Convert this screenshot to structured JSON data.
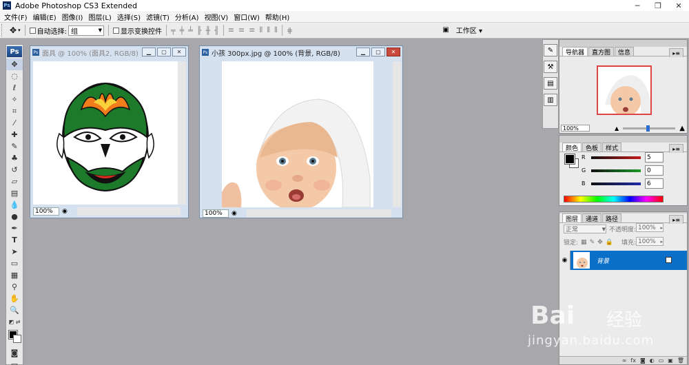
{
  "app": {
    "title": "Adobe Photoshop CS3 Extended",
    "ps_label": "Ps",
    "win_minimize": "─",
    "win_restore": "❐",
    "win_close": "✕"
  },
  "menu": [
    "文件(F)",
    "编辑(E)",
    "图像(I)",
    "图层(L)",
    "选择(S)",
    "滤镜(T)",
    "分析(A)",
    "视图(V)",
    "窗口(W)",
    "帮助(H)"
  ],
  "options": {
    "auto_select_label": "自动选择:",
    "auto_select_value": "组",
    "show_transform_label": "显示变换控件",
    "workspace_label": "工作区 ▾"
  },
  "documents": [
    {
      "title": "面具 @ 100% (面具2, RGB/8)",
      "zoom": "100%"
    },
    {
      "title": "小孩 300px.jpg @ 100% (背景, RGB/8)",
      "zoom": "100%"
    }
  ],
  "navigator": {
    "tabs": [
      "导航器",
      "直方图",
      "信息"
    ],
    "zoom": "100%"
  },
  "color_panel": {
    "tabs": [
      "颜色",
      "色板",
      "样式"
    ],
    "channels": [
      {
        "name": "R",
        "value": "5",
        "color": "#c41b1b"
      },
      {
        "name": "G",
        "value": "0",
        "color": "#1a9b2a"
      },
      {
        "name": "B",
        "value": "6",
        "color": "#1f2aa8"
      }
    ]
  },
  "layers_panel": {
    "tabs": [
      "图层",
      "通道",
      "路径"
    ],
    "blend_mode": "正常",
    "opacity_label": "不透明度:",
    "opacity_value": "100%",
    "lock_label": "锁定:",
    "fill_label": "填充:",
    "fill_value": "100%",
    "layer_name": "背景"
  },
  "watermark": {
    "brand": "Bai",
    "brand_cn": "经验",
    "url": "jingyan.baidu.com"
  },
  "colors": {
    "accent": "#0a6fc9",
    "workspace_bg": "#a8a8ac"
  }
}
